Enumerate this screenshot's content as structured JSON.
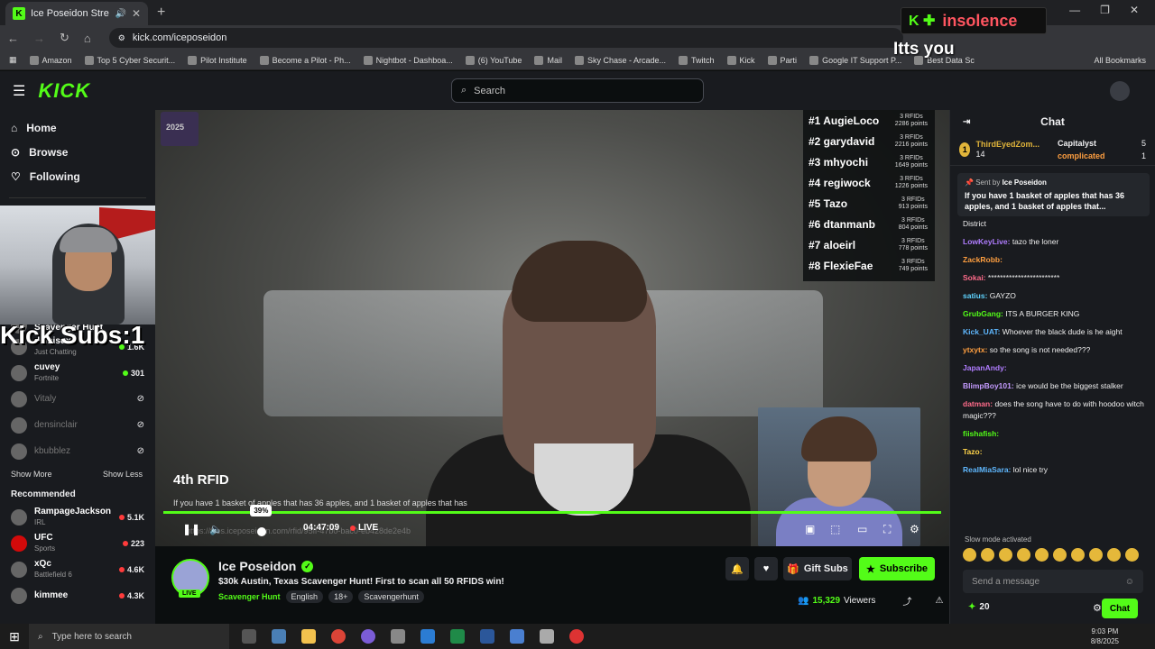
{
  "browser": {
    "tab_title": "Ice Poseidon Stream - Watc",
    "url": "kick.com/iceposeidon",
    "bookmarks": [
      "Amazon",
      "Top 5 Cyber Securit...",
      "Pilot Institute",
      "Become a Pilot - Ph...",
      "Nightbot - Dashboa...",
      "(6) YouTube",
      "Mail",
      "Sky Chase - Arcade...",
      "Twitch",
      "Kick",
      "Parti",
      "Google IT Support P...",
      "Best Data Sc"
    ],
    "all_bookmarks": "All Bookmarks"
  },
  "header": {
    "logo": "KICK",
    "search_placeholder": "Search"
  },
  "sidebar": {
    "nav": [
      {
        "label": "Home",
        "icon": "home-icon"
      },
      {
        "label": "Browse",
        "icon": "compass-icon"
      },
      {
        "label": "Following",
        "icon": "heart-icon"
      }
    ],
    "kick_subs": "Kick Subs:1",
    "following": [
      {
        "name": "Scavenger Hunt",
        "sub": "",
        "viewers": "",
        "live": true,
        "partial": true
      },
      {
        "name": "demisux",
        "sub": "Just Chatting",
        "viewers": "1.6K",
        "live": true
      },
      {
        "name": "cuvey",
        "sub": "Fortnite",
        "viewers": "301",
        "live": true
      },
      {
        "name": "Vitaly",
        "sub": "",
        "viewers": "",
        "live": false
      },
      {
        "name": "densinclair",
        "sub": "",
        "viewers": "",
        "live": false
      },
      {
        "name": "kbubblez",
        "sub": "",
        "viewers": "",
        "live": false
      }
    ],
    "show_more": "Show More",
    "show_less": "Show Less",
    "recommended_title": "Recommended",
    "recommended": [
      {
        "name": "RampageJackson",
        "sub": "IRL",
        "viewers": "5.1K"
      },
      {
        "name": "UFC",
        "sub": "Sports",
        "viewers": "223"
      },
      {
        "name": "xQc",
        "sub": "Battlefield 6",
        "viewers": "4.6K"
      },
      {
        "name": "kimmee",
        "sub": "",
        "viewers": "4.3K"
      }
    ]
  },
  "video": {
    "corner_badge": "2025",
    "leaderboard": [
      {
        "rank": "#1 AugieLoco",
        "rfids": "3 RFIDs",
        "points": "2286 points"
      },
      {
        "rank": "#2 garydavid",
        "rfids": "3 RFIDs",
        "points": "2216 points"
      },
      {
        "rank": "#3 mhyochi",
        "rfids": "3 RFIDs",
        "points": "1649 points"
      },
      {
        "rank": "#4 regiwock",
        "rfids": "3 RFIDs",
        "points": "1226 points"
      },
      {
        "rank": "#5 Tazo",
        "rfids": "3 RFIDs",
        "points": "913 points"
      },
      {
        "rank": "#6 dtanmanb",
        "rfids": "3 RFIDs",
        "points": "804 points"
      },
      {
        "rank": "#7 aloeirl",
        "rfids": "3 RFIDs",
        "points": "778 points"
      },
      {
        "rank": "#8 FlexieFae",
        "rfids": "3 RFIDs",
        "points": "749 points"
      }
    ],
    "rfid_title": "4th RFID",
    "rfid_question": "If you have 1 basket of apples that has 36 apples, and 1 basket of apples that has",
    "faint_url": "https://files.iceposeidon.com/rfid/95ff-47b0-bac0-eb428de2e4b",
    "volume_tooltip": "39%",
    "volume_level": 0.39,
    "time": "04:47:09",
    "live_label": "LIVE"
  },
  "channel": {
    "name": "Ice Poseidon",
    "live_badge": "LIVE",
    "title": "$30k Austin, Texas Scavenger Hunt! First to scan all 50 RFIDS win!",
    "category": "Scavenger Hunt",
    "tags": [
      "English",
      "18+",
      "Scavengerhunt"
    ],
    "gift_label": "Gift Subs",
    "subscribe_label": "Subscribe",
    "viewers": "15,329",
    "viewers_label": "Viewers"
  },
  "chat": {
    "title": "Chat",
    "gifters": [
      {
        "rank": "1",
        "name": "ThirdEyedZom...",
        "count": "14"
      },
      {
        "name": "Capitalyst",
        "count": "5"
      },
      {
        "name": "complicated",
        "count": "1"
      }
    ],
    "pinned_sent_by": "Sent by",
    "pinned_author": "Ice Poseidon",
    "pinned_msg": "If you have 1 basket of apples that has 36 apples, and 1 basket of apples that...",
    "messages": [
      {
        "user": "",
        "text": "District",
        "color": "#ffffff"
      },
      {
        "user": "LowKeyLive:",
        "text": "tazo the loner",
        "color": "#b07dff"
      },
      {
        "user": "ZackRobb:",
        "text": "",
        "color": "#ff9f40"
      },
      {
        "user": "Sokai:",
        "text": "************************",
        "color": "#ff6b8a"
      },
      {
        "user": "satius:",
        "text": "GAYZO",
        "color": "#5fd4ff"
      },
      {
        "user": "GrubGang:",
        "text": "ITS A BURGER KING",
        "color": "#53fc18"
      },
      {
        "user": "Kick_UAT:",
        "text": "Whoever the black dude is he aight",
        "color": "#5fb8ff"
      },
      {
        "user": "ytxytx:",
        "text": "so the song is not needed???",
        "color": "#ff9f40"
      },
      {
        "user": "JapanAndy:",
        "text": "",
        "color": "#b07dff"
      },
      {
        "user": "BlimpBoy101:",
        "text": "ice would be the biggest stalker",
        "color": "#c49bff"
      },
      {
        "user": "datman:",
        "text": "does the song have to do with hoodoo witch magic???",
        "color": "#ff6b8a"
      },
      {
        "user": "fiishafish:",
        "text": "",
        "color": "#53fc18"
      },
      {
        "user": "Tazo:",
        "text": "",
        "color": "#ffd44a"
      },
      {
        "user": "RealMiaSara:",
        "text": "lol nice try",
        "color": "#5fb8ff"
      }
    ],
    "slow_mode": "Slow mode activated",
    "input_placeholder": "Send a message",
    "points": "20",
    "chat_button": "Chat"
  },
  "overlay": {
    "brand": "insolence",
    "tts": "Itts you"
  },
  "taskbar": {
    "search_placeholder": "Type here to search",
    "time": "9:03 PM",
    "date": "8/8/2025"
  }
}
